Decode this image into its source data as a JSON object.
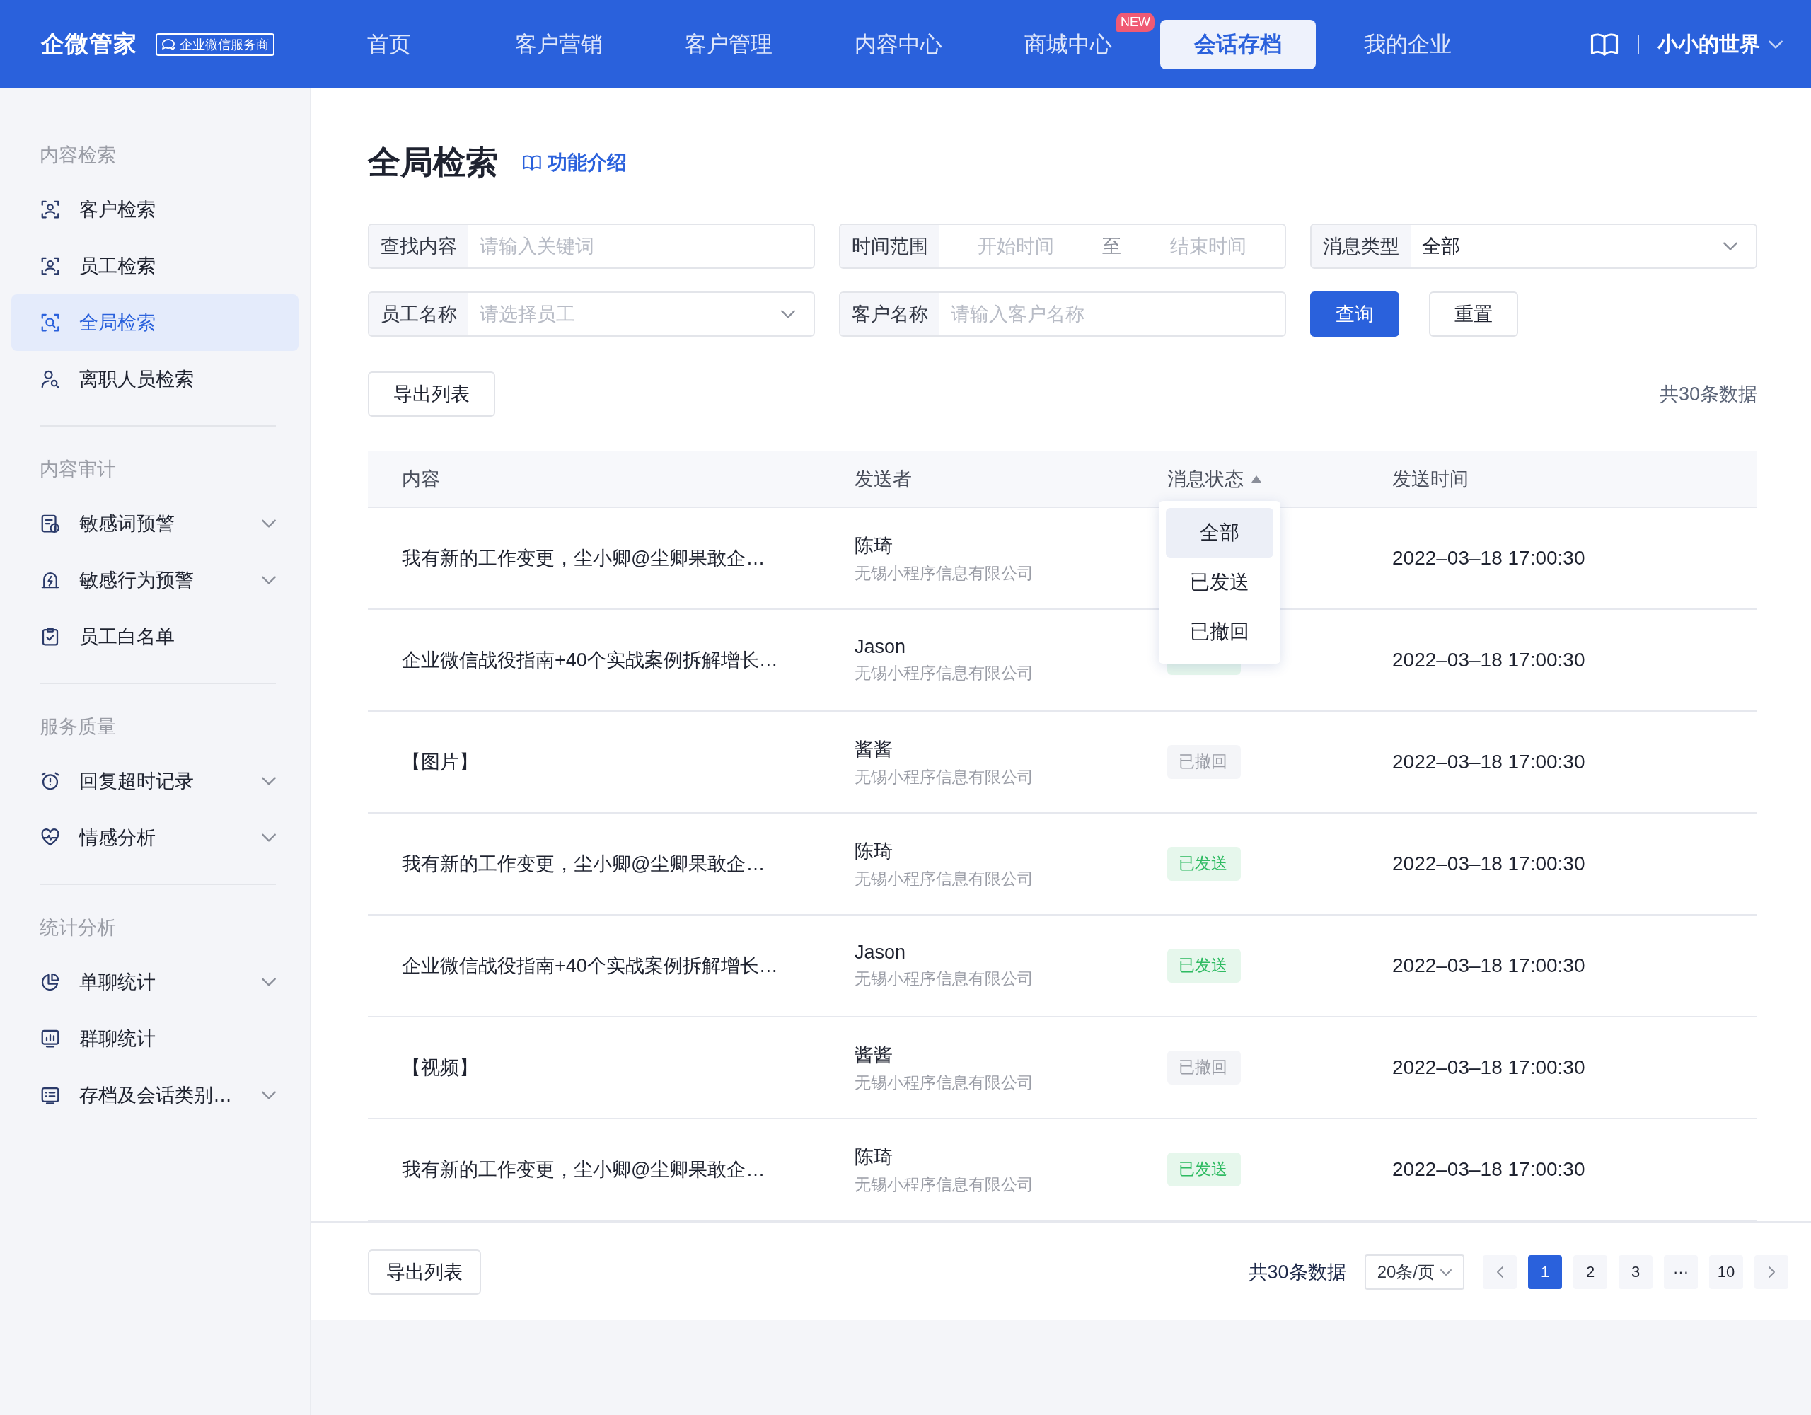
{
  "header": {
    "logo": "企微管家",
    "badge": "企业微信服务商",
    "nav": [
      {
        "label": "首页",
        "selected": false
      },
      {
        "label": "客户营销",
        "selected": false
      },
      {
        "label": "客户管理",
        "selected": false
      },
      {
        "label": "内容中心",
        "selected": false
      },
      {
        "label": "商城中心",
        "selected": false,
        "badge": "NEW"
      },
      {
        "label": "会话存档",
        "selected": true
      },
      {
        "label": "我的企业",
        "selected": false
      }
    ],
    "user": "小小的世界"
  },
  "sidebar": {
    "groups": [
      {
        "title": "内容检索",
        "items": [
          {
            "label": "客户检索",
            "selected": false,
            "has_submenu": false
          },
          {
            "label": "员工检索",
            "selected": false,
            "has_submenu": false
          },
          {
            "label": "全局检索",
            "selected": true,
            "has_submenu": false
          },
          {
            "label": "离职人员检索",
            "selected": false,
            "has_submenu": false
          }
        ]
      },
      {
        "title": "内容审计",
        "items": [
          {
            "label": "敏感词预警",
            "selected": false,
            "has_submenu": true
          },
          {
            "label": "敏感行为预警",
            "selected": false,
            "has_submenu": true
          },
          {
            "label": "员工白名单",
            "selected": false,
            "has_submenu": false
          }
        ]
      },
      {
        "title": "服务质量",
        "items": [
          {
            "label": "回复超时记录",
            "selected": false,
            "has_submenu": true
          },
          {
            "label": "情感分析",
            "selected": false,
            "has_submenu": true
          }
        ]
      },
      {
        "title": "统计分析",
        "items": [
          {
            "label": "单聊统计",
            "selected": false,
            "has_submenu": true
          },
          {
            "label": "群聊统计",
            "selected": false,
            "has_submenu": false
          },
          {
            "label": "存档及会话类别…",
            "selected": false,
            "has_submenu": true
          }
        ]
      }
    ]
  },
  "page": {
    "title": "全局检索",
    "help_link": "功能介绍"
  },
  "filters": [
    {
      "kind": "text",
      "label": "查找内容",
      "placeholder": "请输入关键词"
    },
    {
      "kind": "range",
      "label": "时间范围",
      "start_placeholder": "开始时间",
      "separator": "至",
      "end_placeholder": "结束时间"
    },
    {
      "kind": "select",
      "label": "消息类型",
      "value": "全部"
    },
    {
      "kind": "select",
      "label": "员工名称",
      "placeholder": "请选择员工"
    },
    {
      "kind": "text",
      "label": "客户名称",
      "placeholder": "请输入客户名称"
    }
  ],
  "buttons": {
    "query": "查询",
    "reset": "重置"
  },
  "toolbar": {
    "export_button": "导出列表",
    "total": "共30条数据"
  },
  "table": {
    "columns": [
      {
        "label": "内容"
      },
      {
        "label": "发送者"
      },
      {
        "label": "消息状态",
        "filter": true
      },
      {
        "label": "发送时间"
      }
    ],
    "rows": [
      {
        "content": "我有新的工作变更，尘小卿@尘卿果敢企…",
        "sender": "陈琦",
        "company": "无锡小程序信息有限公司",
        "time": "2022–03–18 17:00:30"
      },
      {
        "content": "企业微信战役指南+40个实战案例拆解增长…",
        "sender": "Jason",
        "company": "无锡小程序信息有限公司",
        "status": {
          "kind": "sent"
        },
        "time": "2022–03–18 17:00:30"
      },
      {
        "content": "【图片】",
        "sender": "酱酱",
        "company": "无锡小程序信息有限公司",
        "status": {
          "kind": "recalled",
          "label": "已撤回"
        },
        "time": "2022–03–18 17:00:30"
      },
      {
        "content": "我有新的工作变更，尘小卿@尘卿果敢企…",
        "sender": "陈琦",
        "company": "无锡小程序信息有限公司",
        "status": {
          "kind": "sent",
          "label": "已发送"
        },
        "time": "2022–03–18 17:00:30"
      },
      {
        "content": "企业微信战役指南+40个实战案例拆解增长…",
        "sender": "Jason",
        "company": "无锡小程序信息有限公司",
        "status": {
          "kind": "sent",
          "label": "已发送"
        },
        "time": "2022–03–18 17:00:30"
      },
      {
        "content": "【视频】",
        "sender": "酱酱",
        "company": "无锡小程序信息有限公司",
        "status": {
          "kind": "recalled",
          "label": "已撤回"
        },
        "time": "2022–03–18 17:00:30"
      },
      {
        "content": "我有新的工作变更，尘小卿@尘卿果敢企…",
        "sender": "陈琦",
        "company": "无锡小程序信息有限公司",
        "status": {
          "kind": "sent",
          "label": "已发送"
        },
        "time": "2022–03–18 17:00:30"
      }
    ]
  },
  "status_menu": {
    "options": [
      {
        "label": "全部",
        "selected": true
      },
      {
        "label": "已发送",
        "selected": false
      },
      {
        "label": "已撤回",
        "selected": false
      }
    ]
  },
  "footer": {
    "export_button": "导出列表",
    "total": "共30条数据",
    "page_size": "20条/页",
    "pages": [
      {
        "label": "1",
        "selected": true
      },
      {
        "label": "2",
        "selected": false
      },
      {
        "label": "3",
        "selected": false
      },
      {
        "label": "···",
        "selected": false
      },
      {
        "label": "10",
        "selected": false
      }
    ]
  }
}
